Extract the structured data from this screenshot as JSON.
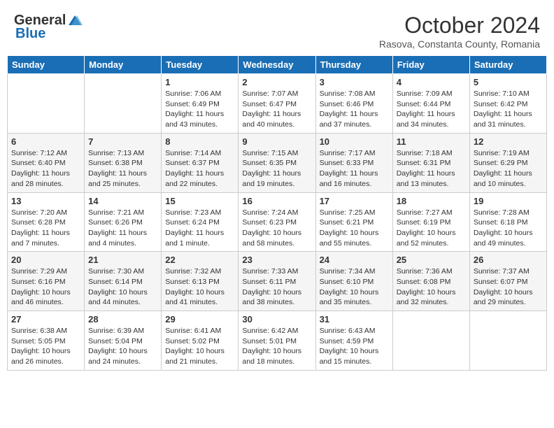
{
  "logo": {
    "general": "General",
    "blue": "Blue"
  },
  "header": {
    "month": "October 2024",
    "location": "Rasova, Constanta County, Romania"
  },
  "weekdays": [
    "Sunday",
    "Monday",
    "Tuesday",
    "Wednesday",
    "Thursday",
    "Friday",
    "Saturday"
  ],
  "weeks": [
    [
      {
        "day": "",
        "sunrise": "",
        "sunset": "",
        "daylight": ""
      },
      {
        "day": "",
        "sunrise": "",
        "sunset": "",
        "daylight": ""
      },
      {
        "day": "1",
        "sunrise": "Sunrise: 7:06 AM",
        "sunset": "Sunset: 6:49 PM",
        "daylight": "Daylight: 11 hours and 43 minutes."
      },
      {
        "day": "2",
        "sunrise": "Sunrise: 7:07 AM",
        "sunset": "Sunset: 6:47 PM",
        "daylight": "Daylight: 11 hours and 40 minutes."
      },
      {
        "day": "3",
        "sunrise": "Sunrise: 7:08 AM",
        "sunset": "Sunset: 6:46 PM",
        "daylight": "Daylight: 11 hours and 37 minutes."
      },
      {
        "day": "4",
        "sunrise": "Sunrise: 7:09 AM",
        "sunset": "Sunset: 6:44 PM",
        "daylight": "Daylight: 11 hours and 34 minutes."
      },
      {
        "day": "5",
        "sunrise": "Sunrise: 7:10 AM",
        "sunset": "Sunset: 6:42 PM",
        "daylight": "Daylight: 11 hours and 31 minutes."
      }
    ],
    [
      {
        "day": "6",
        "sunrise": "Sunrise: 7:12 AM",
        "sunset": "Sunset: 6:40 PM",
        "daylight": "Daylight: 11 hours and 28 minutes."
      },
      {
        "day": "7",
        "sunrise": "Sunrise: 7:13 AM",
        "sunset": "Sunset: 6:38 PM",
        "daylight": "Daylight: 11 hours and 25 minutes."
      },
      {
        "day": "8",
        "sunrise": "Sunrise: 7:14 AM",
        "sunset": "Sunset: 6:37 PM",
        "daylight": "Daylight: 11 hours and 22 minutes."
      },
      {
        "day": "9",
        "sunrise": "Sunrise: 7:15 AM",
        "sunset": "Sunset: 6:35 PM",
        "daylight": "Daylight: 11 hours and 19 minutes."
      },
      {
        "day": "10",
        "sunrise": "Sunrise: 7:17 AM",
        "sunset": "Sunset: 6:33 PM",
        "daylight": "Daylight: 11 hours and 16 minutes."
      },
      {
        "day": "11",
        "sunrise": "Sunrise: 7:18 AM",
        "sunset": "Sunset: 6:31 PM",
        "daylight": "Daylight: 11 hours and 13 minutes."
      },
      {
        "day": "12",
        "sunrise": "Sunrise: 7:19 AM",
        "sunset": "Sunset: 6:29 PM",
        "daylight": "Daylight: 11 hours and 10 minutes."
      }
    ],
    [
      {
        "day": "13",
        "sunrise": "Sunrise: 7:20 AM",
        "sunset": "Sunset: 6:28 PM",
        "daylight": "Daylight: 11 hours and 7 minutes."
      },
      {
        "day": "14",
        "sunrise": "Sunrise: 7:21 AM",
        "sunset": "Sunset: 6:26 PM",
        "daylight": "Daylight: 11 hours and 4 minutes."
      },
      {
        "day": "15",
        "sunrise": "Sunrise: 7:23 AM",
        "sunset": "Sunset: 6:24 PM",
        "daylight": "Daylight: 11 hours and 1 minute."
      },
      {
        "day": "16",
        "sunrise": "Sunrise: 7:24 AM",
        "sunset": "Sunset: 6:23 PM",
        "daylight": "Daylight: 10 hours and 58 minutes."
      },
      {
        "day": "17",
        "sunrise": "Sunrise: 7:25 AM",
        "sunset": "Sunset: 6:21 PM",
        "daylight": "Daylight: 10 hours and 55 minutes."
      },
      {
        "day": "18",
        "sunrise": "Sunrise: 7:27 AM",
        "sunset": "Sunset: 6:19 PM",
        "daylight": "Daylight: 10 hours and 52 minutes."
      },
      {
        "day": "19",
        "sunrise": "Sunrise: 7:28 AM",
        "sunset": "Sunset: 6:18 PM",
        "daylight": "Daylight: 10 hours and 49 minutes."
      }
    ],
    [
      {
        "day": "20",
        "sunrise": "Sunrise: 7:29 AM",
        "sunset": "Sunset: 6:16 PM",
        "daylight": "Daylight: 10 hours and 46 minutes."
      },
      {
        "day": "21",
        "sunrise": "Sunrise: 7:30 AM",
        "sunset": "Sunset: 6:14 PM",
        "daylight": "Daylight: 10 hours and 44 minutes."
      },
      {
        "day": "22",
        "sunrise": "Sunrise: 7:32 AM",
        "sunset": "Sunset: 6:13 PM",
        "daylight": "Daylight: 10 hours and 41 minutes."
      },
      {
        "day": "23",
        "sunrise": "Sunrise: 7:33 AM",
        "sunset": "Sunset: 6:11 PM",
        "daylight": "Daylight: 10 hours and 38 minutes."
      },
      {
        "day": "24",
        "sunrise": "Sunrise: 7:34 AM",
        "sunset": "Sunset: 6:10 PM",
        "daylight": "Daylight: 10 hours and 35 minutes."
      },
      {
        "day": "25",
        "sunrise": "Sunrise: 7:36 AM",
        "sunset": "Sunset: 6:08 PM",
        "daylight": "Daylight: 10 hours and 32 minutes."
      },
      {
        "day": "26",
        "sunrise": "Sunrise: 7:37 AM",
        "sunset": "Sunset: 6:07 PM",
        "daylight": "Daylight: 10 hours and 29 minutes."
      }
    ],
    [
      {
        "day": "27",
        "sunrise": "Sunrise: 6:38 AM",
        "sunset": "Sunset: 5:05 PM",
        "daylight": "Daylight: 10 hours and 26 minutes."
      },
      {
        "day": "28",
        "sunrise": "Sunrise: 6:39 AM",
        "sunset": "Sunset: 5:04 PM",
        "daylight": "Daylight: 10 hours and 24 minutes."
      },
      {
        "day": "29",
        "sunrise": "Sunrise: 6:41 AM",
        "sunset": "Sunset: 5:02 PM",
        "daylight": "Daylight: 10 hours and 21 minutes."
      },
      {
        "day": "30",
        "sunrise": "Sunrise: 6:42 AM",
        "sunset": "Sunset: 5:01 PM",
        "daylight": "Daylight: 10 hours and 18 minutes."
      },
      {
        "day": "31",
        "sunrise": "Sunrise: 6:43 AM",
        "sunset": "Sunset: 4:59 PM",
        "daylight": "Daylight: 10 hours and 15 minutes."
      },
      {
        "day": "",
        "sunrise": "",
        "sunset": "",
        "daylight": ""
      },
      {
        "day": "",
        "sunrise": "",
        "sunset": "",
        "daylight": ""
      }
    ]
  ]
}
